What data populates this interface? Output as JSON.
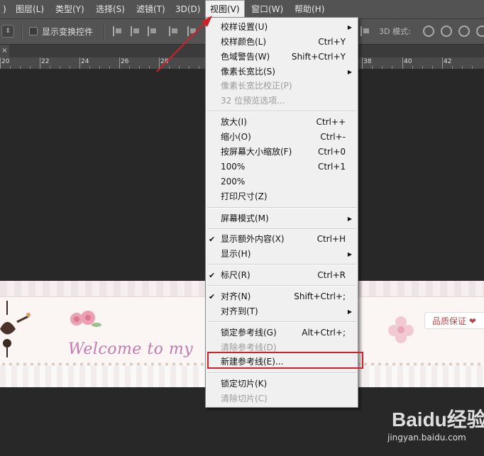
{
  "menubar": {
    "items": [
      {
        "label": ")"
      },
      {
        "label": "图层(L)"
      },
      {
        "label": "类型(Y)"
      },
      {
        "label": "选择(S)"
      },
      {
        "label": "滤镜(T)"
      },
      {
        "label": "3D(D)"
      },
      {
        "label": "视图(V)"
      },
      {
        "label": "窗口(W)"
      },
      {
        "label": "帮助(H)"
      }
    ]
  },
  "options": {
    "show_transform_label": "显示变换控件",
    "mode_label": "3D 模式:"
  },
  "tab": {
    "close": "×"
  },
  "ruler": {
    "labels": [
      "20",
      "22",
      "24",
      "26",
      "28",
      "38",
      "40",
      "42"
    ]
  },
  "dropdown": {
    "items": [
      {
        "label": "校样设置(U)",
        "shortcut": "",
        "submenu": true,
        "disabled": false,
        "checked": false
      },
      {
        "label": "校样颜色(L)",
        "shortcut": "Ctrl+Y",
        "submenu": false,
        "disabled": false,
        "checked": false
      },
      {
        "label": "色域警告(W)",
        "shortcut": "Shift+Ctrl+Y",
        "submenu": false,
        "disabled": false,
        "checked": false
      },
      {
        "label": "像素长宽比(S)",
        "shortcut": "",
        "submenu": true,
        "disabled": false,
        "checked": false
      },
      {
        "label": "像素长宽比校正(P)",
        "shortcut": "",
        "submenu": false,
        "disabled": true,
        "checked": false
      },
      {
        "label": "32 位预览选项...",
        "shortcut": "",
        "submenu": false,
        "disabled": true,
        "checked": false
      },
      {
        "label": "放大(I)",
        "shortcut": "Ctrl++",
        "submenu": false,
        "disabled": false,
        "checked": false
      },
      {
        "label": "缩小(O)",
        "shortcut": "Ctrl+-",
        "submenu": false,
        "disabled": false,
        "checked": false
      },
      {
        "label": "按屏幕大小缩放(F)",
        "shortcut": "Ctrl+0",
        "submenu": false,
        "disabled": false,
        "checked": false
      },
      {
        "label": "100%",
        "shortcut": "Ctrl+1",
        "submenu": false,
        "disabled": false,
        "checked": false
      },
      {
        "label": "200%",
        "shortcut": "",
        "submenu": false,
        "disabled": false,
        "checked": false
      },
      {
        "label": "打印尺寸(Z)",
        "shortcut": "",
        "submenu": false,
        "disabled": false,
        "checked": false
      },
      {
        "label": "屏幕模式(M)",
        "shortcut": "",
        "submenu": true,
        "disabled": false,
        "checked": false
      },
      {
        "label": "显示额外内容(X)",
        "shortcut": "Ctrl+H",
        "submenu": false,
        "disabled": false,
        "checked": true
      },
      {
        "label": "显示(H)",
        "shortcut": "",
        "submenu": true,
        "disabled": false,
        "checked": false
      },
      {
        "label": "标尺(R)",
        "shortcut": "Ctrl+R",
        "submenu": false,
        "disabled": false,
        "checked": true
      },
      {
        "label": "对齐(N)",
        "shortcut": "Shift+Ctrl+;",
        "submenu": false,
        "disabled": false,
        "checked": true
      },
      {
        "label": "对齐到(T)",
        "shortcut": "",
        "submenu": true,
        "disabled": false,
        "checked": false
      },
      {
        "label": "锁定参考线(G)",
        "shortcut": "Alt+Ctrl+;",
        "submenu": false,
        "disabled": false,
        "checked": false
      },
      {
        "label": "清除参考线(D)",
        "shortcut": "",
        "submenu": false,
        "disabled": true,
        "checked": false
      },
      {
        "label": "新建参考线(E)...",
        "shortcut": "",
        "submenu": false,
        "disabled": false,
        "checked": false
      },
      {
        "label": "锁定切片(K)",
        "shortcut": "",
        "submenu": false,
        "disabled": false,
        "checked": false
      },
      {
        "label": "清除切片(C)",
        "shortcut": "",
        "submenu": false,
        "disabled": true,
        "checked": false
      }
    ]
  },
  "banner": {
    "welcome_text": "Welcome to my",
    "quality_text": "品质保证 ❤"
  },
  "watermark": {
    "logo": "Baidu经验",
    "url": "jingyan.baidu.com"
  },
  "colors": {
    "highlight": "#d0202a",
    "arrow": "#d0202a"
  }
}
